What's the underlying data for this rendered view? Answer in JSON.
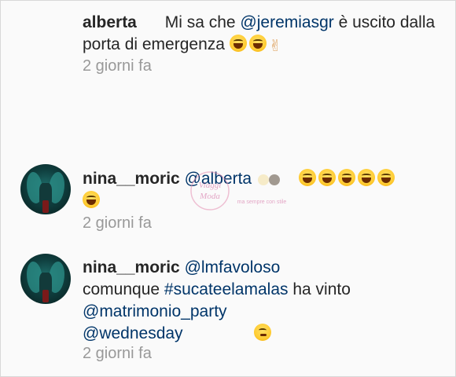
{
  "comments": [
    {
      "user": "alberta",
      "text_before": "Mi sa che ",
      "mention": "@jeremiasgr",
      "text_after": " è uscito dalla porta di emergenza",
      "time": "2 giorni fa"
    },
    {
      "user": "nina__moric",
      "mention": "@alberta",
      "time": "2 giorni fa"
    },
    {
      "user": "nina__moric",
      "mention1": "@lmfavoloso",
      "text1": "comunque ",
      "hashtag": "#sucateelamalas",
      "text2": " ha vinto ",
      "mention2": "@matrimonio_party",
      "mention3": "@wednesday",
      "time": "2 giorni fa"
    }
  ],
  "watermark": {
    "label_top": "Viaggi",
    "label_mid": "Moda",
    "label_right": "ma sempre con stile"
  },
  "icons": {
    "laugh": "grinning-squinting-face-emoji",
    "victory": "victory-hand-emoji",
    "think": "thinking-face-emoji"
  },
  "colors": {
    "mention": "#003569",
    "meta": "#999999",
    "text": "#262626"
  }
}
